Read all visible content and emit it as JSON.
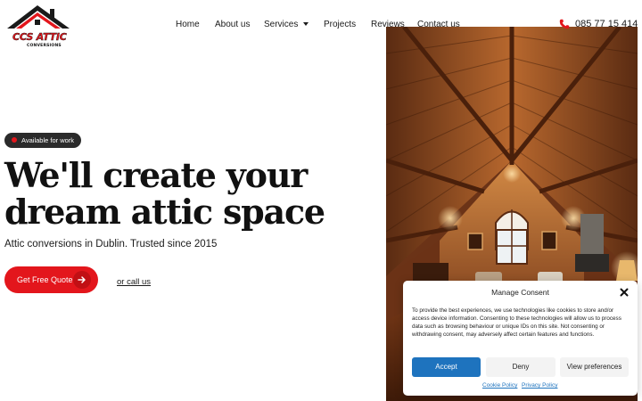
{
  "brand": {
    "logo_text": "CCS ATTIC",
    "logo_subtext": "CONVERSIONS",
    "accent_color": "#e3161c"
  },
  "nav": {
    "items": [
      {
        "label": "Home"
      },
      {
        "label": "About us"
      },
      {
        "label": "Services",
        "has_dropdown": true
      },
      {
        "label": "Projects"
      },
      {
        "label": "Reviews"
      },
      {
        "label": "Contact us"
      }
    ]
  },
  "header": {
    "phone_icon": "phone-icon",
    "phone_number": "085 77 15 414"
  },
  "hero": {
    "badge": "Available for work",
    "headline_line1": "We'll create your",
    "headline_line2": "dream attic space",
    "subline": "Attic conversions in Dublin. Trusted since 2015",
    "cta_label": "Get Free Quote",
    "cta_icon": "arrow-right-icon",
    "call_link": "or call us",
    "image_subject": "attic-interior-photo"
  },
  "consent": {
    "title": "Manage Consent",
    "close_icon": "close-icon",
    "body": "To provide the best experiences, we use technologies like cookies to store and/or access device information. Consenting to these technologies will allow us to process data such as browsing behaviour or unique IDs on this site. Not consenting or withdrawing consent, may adversely affect certain features and functions.",
    "accept_label": "Accept",
    "deny_label": "Deny",
    "preferences_label": "View preferences",
    "cookie_policy_label": "Cookie Policy",
    "privacy_policy_label": "Privacy Policy",
    "accept_color": "#1e73be"
  }
}
